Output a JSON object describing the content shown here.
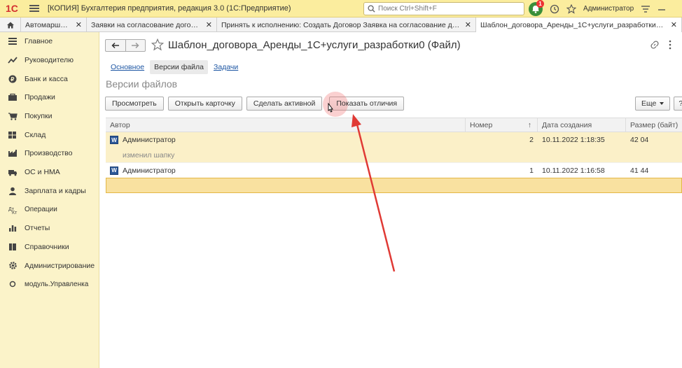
{
  "titlebar": {
    "app_title": "[КОПИЯ] Бухгалтерия предприятия, редакция 3.0  (1С:Предприятие)",
    "search_placeholder": "Поиск Ctrl+Shift+F",
    "notification_count": "1",
    "user_name": "Администратор"
  },
  "tabs": [
    {
      "label": "Автомаршруты"
    },
    {
      "label": "Заявки на согласование договоров"
    },
    {
      "label": "Принять к исполнению: Создать Договор Заявка на согласование догов..."
    },
    {
      "label": "Шаблон_договора_Аренды_1С+услуги_разработки0 (Файл)"
    }
  ],
  "sidebar": {
    "items": [
      {
        "label": "Главное",
        "icon": "menu-icon"
      },
      {
        "label": "Руководителю",
        "icon": "trend-icon"
      },
      {
        "label": "Банк и касса",
        "icon": "coin-icon"
      },
      {
        "label": "Продажи",
        "icon": "cart-icon"
      },
      {
        "label": "Покупки",
        "icon": "basket-icon"
      },
      {
        "label": "Склад",
        "icon": "warehouse-icon"
      },
      {
        "label": "Производство",
        "icon": "factory-icon"
      },
      {
        "label": "ОС и НМА",
        "icon": "truck-icon"
      },
      {
        "label": "Зарплата и кадры",
        "icon": "person-icon"
      },
      {
        "label": "Операции",
        "icon": "operations-icon"
      },
      {
        "label": "Отчеты",
        "icon": "bar-chart-icon"
      },
      {
        "label": "Справочники",
        "icon": "book-icon"
      },
      {
        "label": "Администрирование",
        "icon": "gear-icon"
      },
      {
        "label": "модуль.Управленка",
        "icon": "module-icon"
      }
    ]
  },
  "document": {
    "title": "Шаблон_договора_Аренды_1С+услуги_разработки0 (Файл)"
  },
  "subtabs": {
    "main": "Основное",
    "versions": "Версии файла",
    "tasks": "Задачи"
  },
  "section": {
    "title": "Версии файлов"
  },
  "toolbar": {
    "view": "Просмотреть",
    "open_card": "Открыть карточку",
    "make_active": "Сделать активной",
    "show_diff": "Показать отличия",
    "more": "Еще",
    "help": "?"
  },
  "table": {
    "columns": [
      "Автор",
      "Номер",
      "Дата создания",
      "Размер (байт)"
    ],
    "rows": [
      {
        "author": "Администратор",
        "number": "2",
        "date": "10.11.2022 1:18:35",
        "size": "42 04",
        "comment": "изменил шапку"
      },
      {
        "author": "Администратор",
        "number": "1",
        "date": "10.11.2022 1:16:58",
        "size": "41 44"
      }
    ]
  }
}
